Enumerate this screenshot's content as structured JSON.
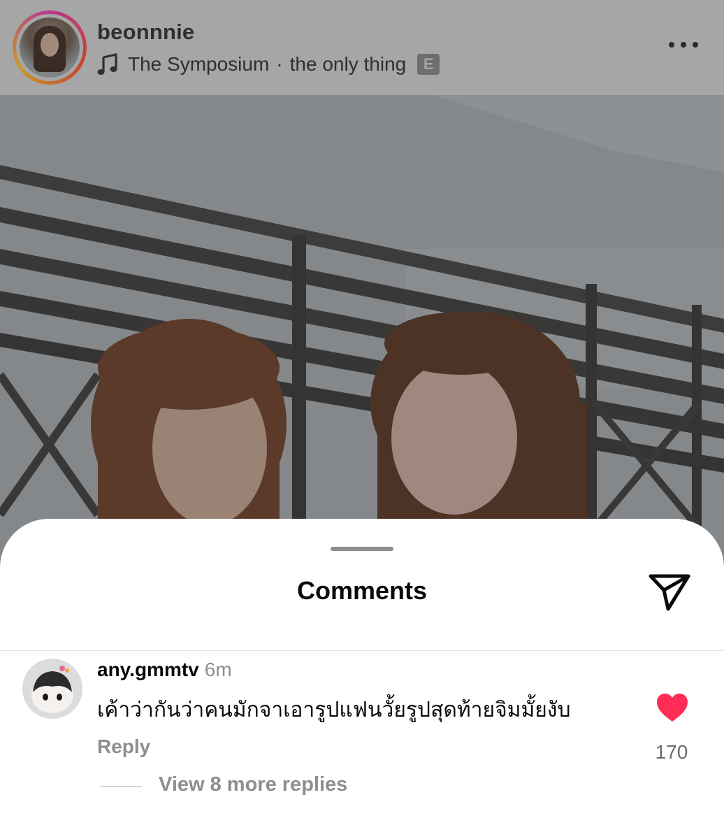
{
  "post": {
    "username": "beonnnie",
    "music": {
      "artist": "The Symposium",
      "separator": "·",
      "track": "the only thing",
      "explicit_badge": "E"
    },
    "icons": {
      "music": "music-note-icon",
      "more": "more-dots-icon"
    }
  },
  "comments_sheet": {
    "title": "Comments",
    "share_icon": "paper-plane-icon",
    "comments": [
      {
        "username": "any.gmmtv",
        "time": "6m",
        "text": "เค้าว่ากันว่าคนมักจาเอารูปแฟนวั้ยรูปสุดท้ายจิมมั้ยงับ",
        "reply_label": "Reply",
        "like_count": "170",
        "liked": true,
        "view_replies": "View 8 more replies"
      }
    ]
  },
  "colors": {
    "like_red": "#ff2d55",
    "dim_overlay": "#a6a6a6"
  }
}
